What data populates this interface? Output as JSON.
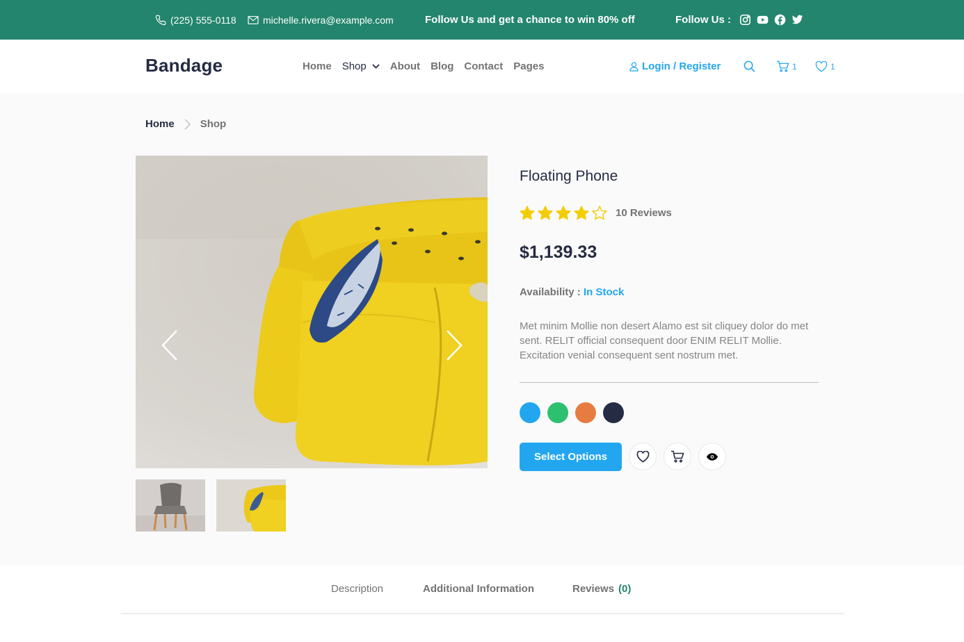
{
  "topbar": {
    "phone": "(225) 555-0118",
    "email": "michelle.rivera@example.com",
    "promo": "Follow Us  and get a chance to win 80% off",
    "follow_label": "Follow Us  :",
    "social_icons": [
      "instagram-icon",
      "youtube-icon",
      "facebook-icon",
      "twitter-icon"
    ],
    "bg_color": "#23856d"
  },
  "header": {
    "logo": "Bandage",
    "nav": [
      "Home",
      "Shop",
      "About",
      "Blog",
      "Contact",
      "Pages"
    ],
    "login": "Login / Register",
    "cart_count": "1",
    "wishlist_count": "1",
    "accent_color": "#23a6f0"
  },
  "breadcrumb": {
    "home": "Home",
    "current": "Shop"
  },
  "product": {
    "name": "Floating Phone",
    "rating": 4,
    "rating_max": 5,
    "reviews": "10 Reviews",
    "price": "$1,139.33",
    "availability_label": "Availability :",
    "availability_value": "In Stock",
    "description": "Met minim Mollie non desert Alamo est sit cliquey dolor do met sent. RELIT official consequent door ENIM RELIT Mollie. Excitation venial consequent sent nostrum met.",
    "colors": [
      "#23a6f0",
      "#2dc071",
      "#e77c40",
      "#252b42"
    ],
    "select_button": "Select Options",
    "images": [
      "yellow-sofa-photo",
      "chair-photo"
    ]
  },
  "tabs": {
    "description": "Description",
    "additional": "Additional Information",
    "reviews": "Reviews",
    "reviews_count": "(0)"
  }
}
